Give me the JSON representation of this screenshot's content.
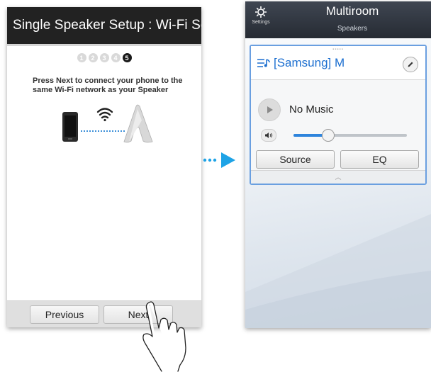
{
  "setup_screen": {
    "title": "Single Speaker Setup : Wi-Fi Setup",
    "steps": [
      "1",
      "2",
      "3",
      "4",
      "5"
    ],
    "active_step": "5",
    "instruction": "Press Next to connect your phone to the same Wi-Fi network as your Speaker",
    "previous_label": "Previous",
    "next_label": "Next"
  },
  "multiroom_screen": {
    "title": "Multiroom",
    "subtitle": "Speakers",
    "settings_label": "Settings",
    "speaker_name": "[Samsung] M",
    "now_playing": "No Music",
    "volume_level": 0.3,
    "source_label": "Source",
    "eq_label": "EQ"
  },
  "colors": {
    "accent_blue": "#1c6fd0",
    "arrow_blue": "#1ea3e6",
    "title_bar": "#222222"
  },
  "icons": [
    "wifi-icon",
    "phone-icon",
    "speaker-device-icon",
    "tap-hand-icon",
    "arrow-right-icon",
    "gear-icon",
    "speaker-list-icon",
    "edit-icon",
    "play-icon",
    "volume-icon",
    "chevron-up-icon"
  ]
}
